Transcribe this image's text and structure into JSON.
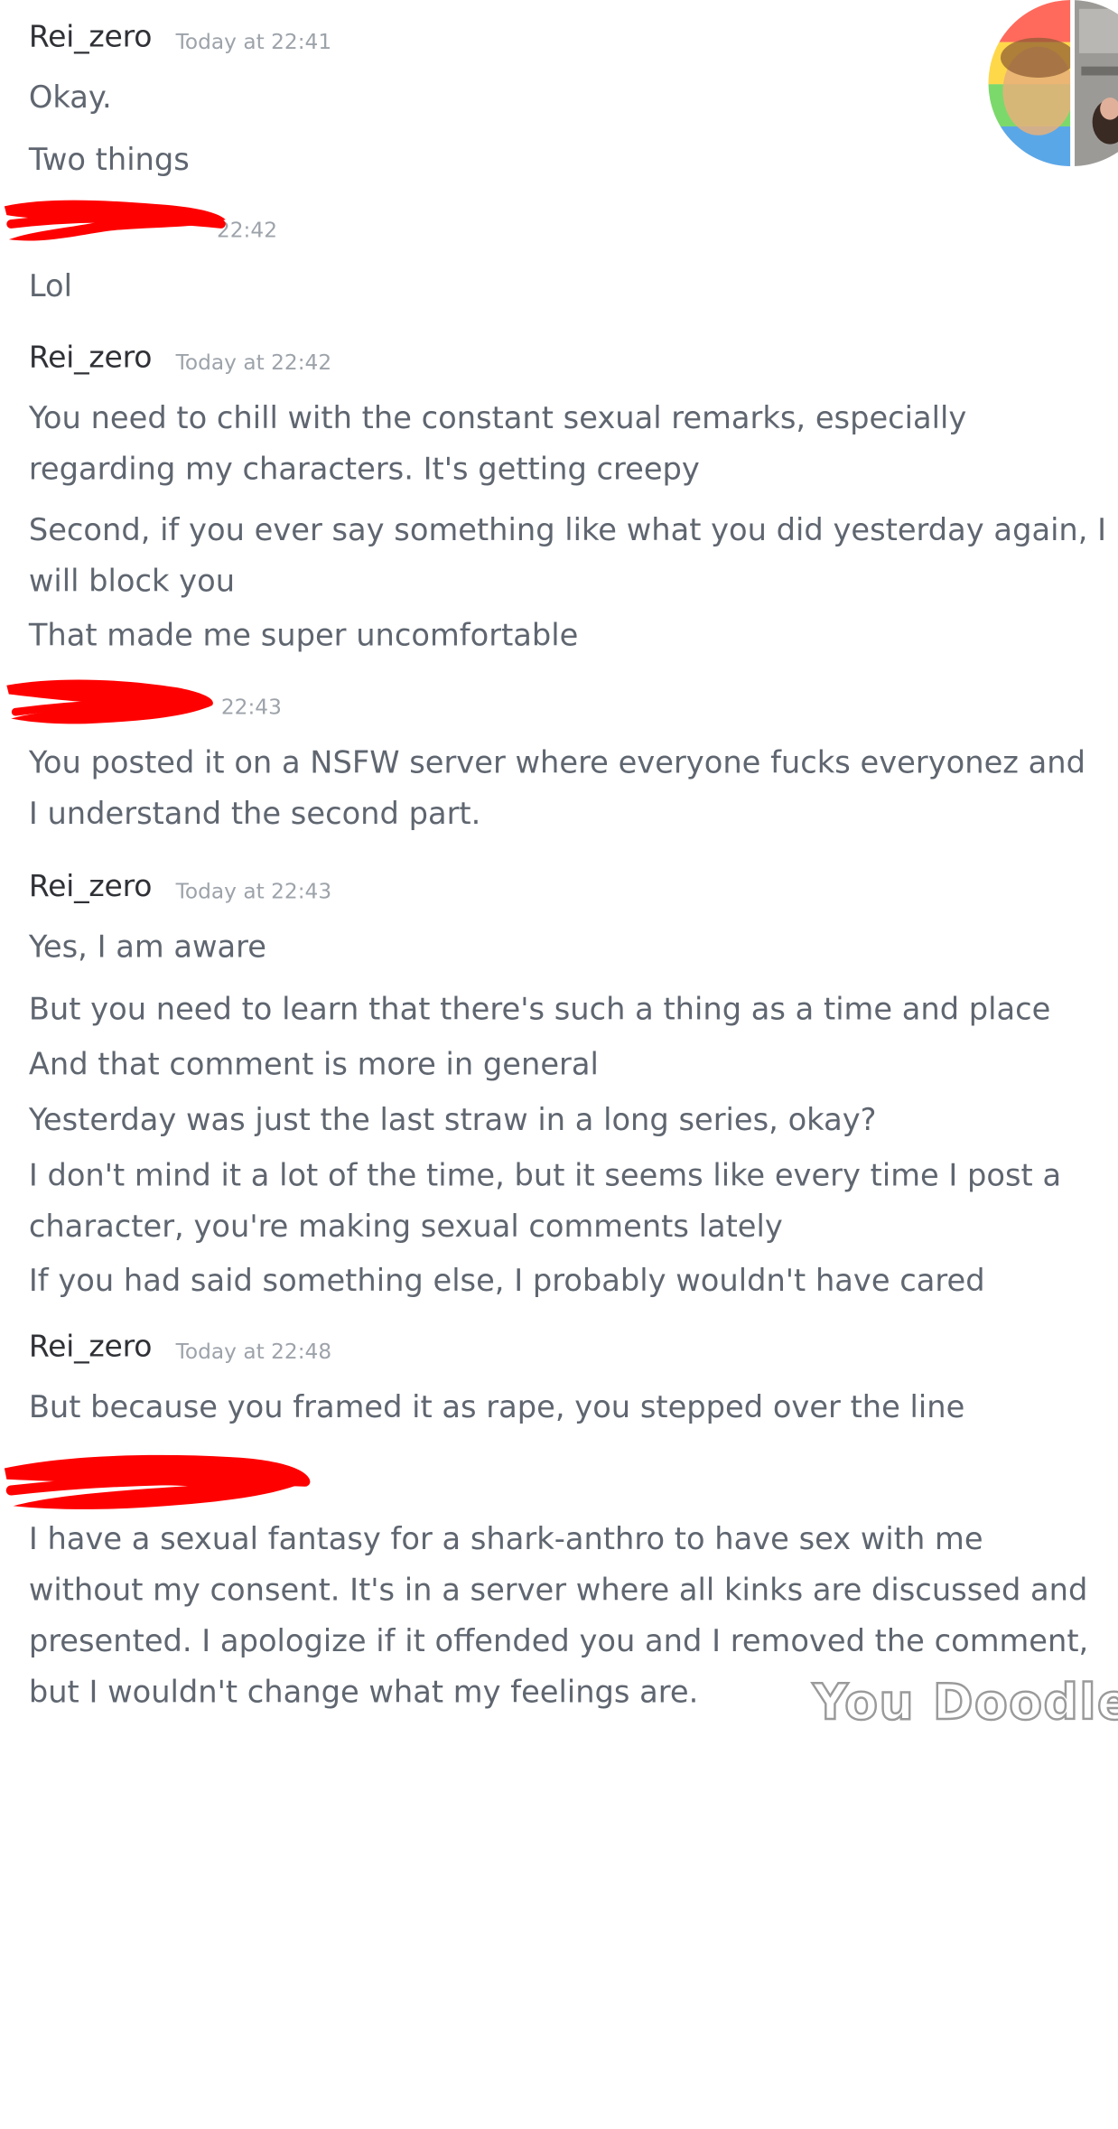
{
  "messages": [
    {
      "author": "Rei_zero",
      "timestamp": "Today at 22:41",
      "lines": [
        "Okay.",
        "Two things"
      ]
    },
    {
      "author": "",
      "timestamp": "22:42",
      "lines": [
        "Lol"
      ]
    },
    {
      "author": "Rei_zero",
      "timestamp": "Today at 22:42",
      "lines": [
        "You need to chill with the constant sexual remarks, especially",
        "regarding my characters. It's getting creepy",
        "Second, if you ever say something like what you did yesterday again, I",
        "will block you",
        "That made me super uncomfortable"
      ]
    },
    {
      "author": "",
      "timestamp": "22:43",
      "lines": [
        "You posted it on a NSFW server where everyone fucks everyonez and",
        "I understand the second part."
      ]
    },
    {
      "author": "Rei_zero",
      "timestamp": "Today at 22:43",
      "lines": [
        "Yes, I am aware",
        "But you need to learn that there's such a thing as a time and place",
        "And that comment is more in general",
        "Yesterday was just the last straw in a long series, okay?",
        "I don't mind it a lot of the time, but it seems like every time I post a",
        "character, you're making sexual comments lately",
        "If you had said something else, I probably wouldn't have cared"
      ]
    },
    {
      "author": "Rei_zero",
      "timestamp": "Today at 22:48",
      "lines": [
        "But because you framed it as rape, you stepped over the line"
      ]
    },
    {
      "author": "",
      "timestamp": "",
      "lines": [
        "I have a sexual fantasy for a shark-anthro to have sex with me",
        "without my consent. It's in a server where all kinks are discussed and",
        "presented. I apologize if it offended you and I removed the comment,",
        "but I wouldn't change what my feelings are."
      ]
    }
  ],
  "watermark": "You Doodle",
  "colors": {
    "redaction": "#ff0000",
    "text": "#5f6670",
    "username": "#2f3136",
    "timestamp": "#9da3aa"
  }
}
